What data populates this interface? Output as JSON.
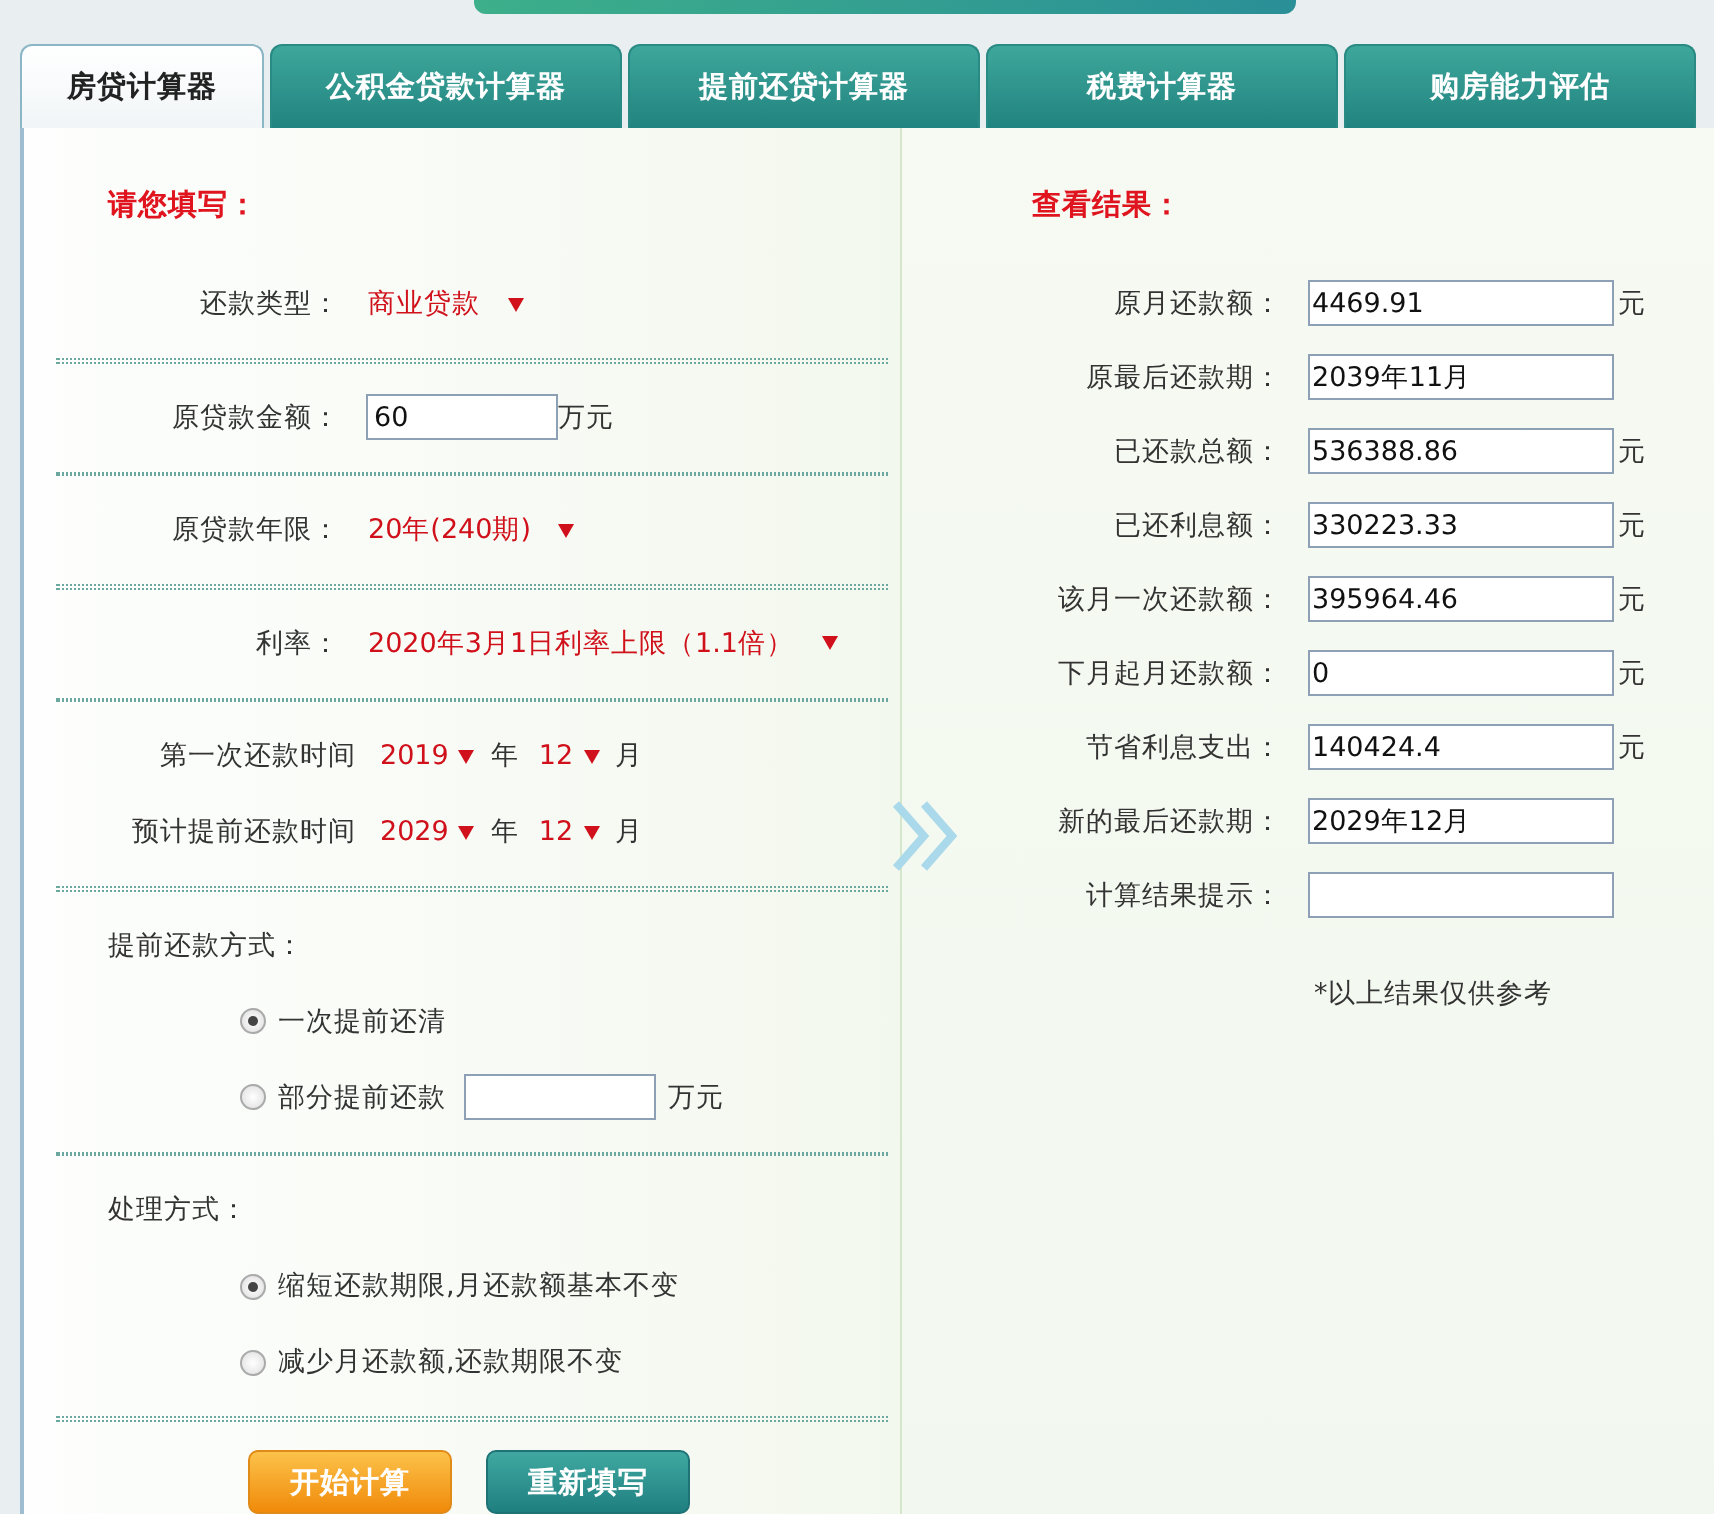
{
  "tabs": [
    {
      "label": "房贷计算器",
      "selected": true
    },
    {
      "label": "公积金贷款计算器",
      "selected": false
    },
    {
      "label": "提前还贷计算器",
      "selected": false
    },
    {
      "label": "税费计算器",
      "selected": false
    },
    {
      "label": "购房能力评估",
      "selected": false
    }
  ],
  "input_form": {
    "heading": "请您填写：",
    "sections": [
      [
        {
          "kind": "select",
          "label": "还款类型：",
          "value": "商业贷款"
        }
      ],
      [
        {
          "kind": "input",
          "label": "原贷款金额：",
          "value": "60",
          "unit": "万元"
        }
      ],
      [
        {
          "kind": "select",
          "label": "原贷款年限：",
          "value": "20年(240期)"
        }
      ],
      [
        {
          "kind": "select",
          "label": "利率：",
          "value": "2020年3月1日利率上限（1.1倍）"
        }
      ],
      [
        {
          "kind": "date",
          "label": "第一次还款时间",
          "year": "2019",
          "year_unit": "年",
          "month": "12",
          "month_unit": "月"
        },
        {
          "kind": "date",
          "label": "预计提前还款时间",
          "year": "2029",
          "year_unit": "年",
          "month": "12",
          "month_unit": "月"
        }
      ],
      [
        {
          "kind": "heading",
          "label": "提前还款方式："
        },
        {
          "kind": "radio",
          "label": "一次提前还清",
          "selected": true
        },
        {
          "kind": "radio",
          "label": "部分提前还款",
          "selected": false,
          "unit": "万元"
        }
      ],
      [
        {
          "kind": "heading",
          "label": "处理方式："
        },
        {
          "kind": "radio",
          "label": "缩短还款期限,月还款额基本不变",
          "selected": true
        },
        {
          "kind": "radio",
          "label": "减少月还款额,还款期限不变",
          "selected": false
        }
      ]
    ],
    "buttons": [
      {
        "label": "开始计算",
        "kind": "primary"
      },
      {
        "label": "重新填写",
        "kind": "secondary"
      }
    ]
  },
  "results": {
    "heading": "查看结果：",
    "rows": [
      {
        "label": "原月还款额：",
        "value": "4469.91",
        "unit": "元"
      },
      {
        "label": "原最后还款期：",
        "value": "2039年11月"
      },
      {
        "label": "已还款总额：",
        "value": "536388.86",
        "unit": "元"
      },
      {
        "label": "已还利息额：",
        "value": "330223.33",
        "unit": "元"
      },
      {
        "label": "该月一次还款额：",
        "value": "395964.46",
        "unit": "元"
      },
      {
        "label": "下月起月还款额：",
        "value": "0",
        "unit": "元"
      },
      {
        "label": "节省利息支出：",
        "value": "140424.4",
        "unit": "元"
      },
      {
        "label": "新的最后还款期：",
        "value": "2029年12月"
      },
      {
        "label": "计算结果提示："
      }
    ],
    "note": "*以上结果仅供参考"
  }
}
